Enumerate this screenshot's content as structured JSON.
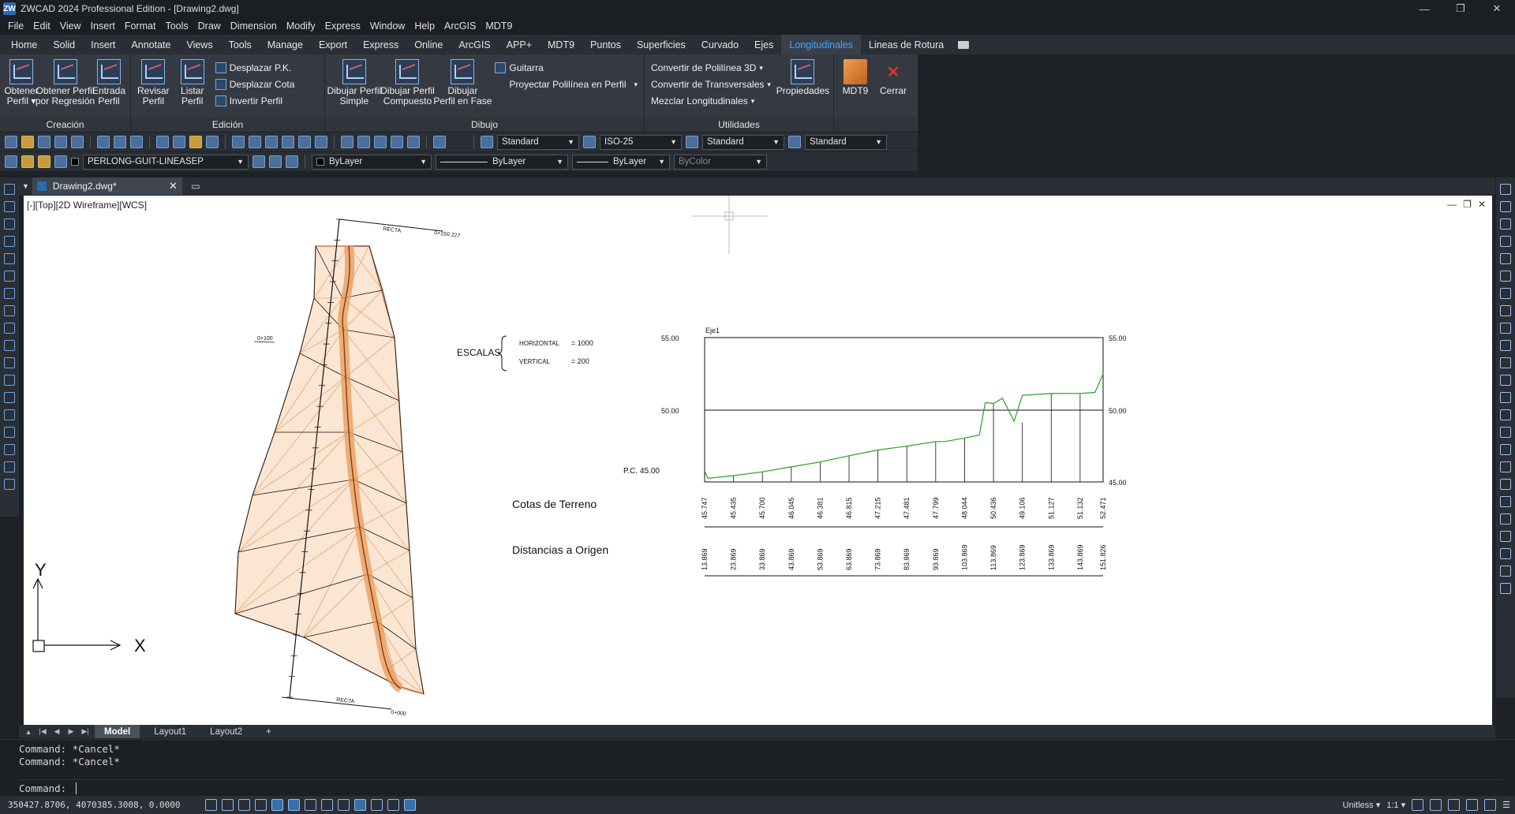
{
  "window": {
    "title": "ZWCAD 2024 Professional Edition - [Drawing2.dwg]",
    "app_icon": "ZW"
  },
  "menu": [
    "File",
    "Edit",
    "View",
    "Insert",
    "Format",
    "Tools",
    "Draw",
    "Dimension",
    "Modify",
    "Express",
    "Window",
    "Help",
    "ArcGIS",
    "MDT9"
  ],
  "ribbon_tabs": [
    "Home",
    "Solid",
    "Insert",
    "Annotate",
    "Views",
    "Tools",
    "Manage",
    "Export",
    "Express",
    "Online",
    "ArcGIS",
    "APP+",
    "MDT9",
    "Puntos",
    "Superficies",
    "Curvado",
    "Ejes",
    "Longitudinales",
    "Lineas de Rotura"
  ],
  "active_ribbon_tab": "Longitudinales",
  "ribbon": {
    "creacion": {
      "label": "Creación",
      "buttons": [
        {
          "l1": "Obtener",
          "l2": "Perfil ▾"
        },
        {
          "l1": "Obtener Perfil",
          "l2": "por Regresión"
        },
        {
          "l1": "Entrada",
          "l2": "Perfil"
        }
      ]
    },
    "edicion": {
      "label": "Edición",
      "buttons": [
        {
          "l1": "Revisar",
          "l2": "Perfil"
        },
        {
          "l1": "Listar",
          "l2": "Perfil"
        }
      ],
      "small": [
        "Desplazar P.K.",
        "Desplazar Cota",
        "Invertir Perfil"
      ]
    },
    "dibujo": {
      "label": "Dibujo",
      "buttons": [
        {
          "l1": "Dibujar Perfil",
          "l2": "Simple"
        },
        {
          "l1": "Dibujar Perfil",
          "l2": "Compuesto"
        },
        {
          "l1": "Dibujar",
          "l2": "Perfil en Fase"
        }
      ],
      "small": [
        "Guitarra",
        "Proyectar Polilínea en Perfil"
      ]
    },
    "utilidades": {
      "label": "Utilidades",
      "small": [
        "Convertir de Polilínea 3D",
        "Convertir de Transversales",
        "Mezclar Longitudinales"
      ],
      "props": "Propiedades"
    },
    "mdt": {
      "mdt9": "MDT9",
      "cerrar": "Cerrar"
    }
  },
  "toolbar": {
    "text_style": "Standard",
    "dim_style": "ISO-25",
    "table_style": "Standard",
    "mleader_style": "Standard",
    "layer": "PERLONG-GUIT-LINEASEP",
    "color": "ByLayer",
    "linetype": "ByLayer",
    "lineweight": "ByLayer",
    "plotstyle": "ByColor"
  },
  "doc_tab": "Drawing2.dwg*",
  "viewport_label": "[-][Top][2D Wireframe][WCS]",
  "drawing": {
    "plan_labels": {
      "recta_top": "RECTA",
      "recta_bottom": "RECTA",
      "pk_top": "0+150.227",
      "pk_mid": "0+100",
      "pk_bottom": "0+000"
    },
    "escalas": {
      "title": "ESCALAS",
      "h_label": "HORIZONTAL",
      "h_value": "= 1000",
      "v_label": "VERTICAL",
      "v_value": "= 200"
    },
    "axis_y": "Y",
    "axis_x": "X",
    "row_labels": {
      "cotas": "Cotas de Terreno",
      "distancias": "Distancias a Origen"
    },
    "pc_label": "P.C. 45.00",
    "y_ticks_left": [
      "55.00",
      "50.00"
    ],
    "y_ticks_right": [
      "55.00",
      "50.00",
      "45.00"
    ]
  },
  "chart_data": {
    "type": "line",
    "title": "Eje1",
    "xlabel": "",
    "ylabel": "",
    "ylim": [
      45,
      55
    ],
    "xlim": [
      13.869,
      151.826
    ],
    "grid": false,
    "series": [
      {
        "x": [
          13.869,
          15.0,
          23.869,
          33.869,
          43.869,
          53.869,
          63.869,
          73.869,
          83.869,
          93.869,
          97.0,
          103.869,
          109.0,
          111.0,
          113.869,
          117.0,
          121.0,
          123.869,
          123.869,
          133.869,
          143.869,
          149.0,
          151.826
        ],
        "y": [
          45.747,
          45.25,
          45.435,
          45.7,
          46.045,
          46.381,
          46.815,
          47.215,
          47.481,
          47.799,
          47.8,
          48.044,
          48.25,
          50.5,
          50.436,
          50.8,
          49.2,
          51.0,
          51.0,
          51.127,
          51.132,
          51.2,
          52.471
        ]
      }
    ],
    "station_labels": [
      "13.869",
      "23.869",
      "33.869",
      "43.869",
      "53.869",
      "63.869",
      "73.869",
      "83.869",
      "93.869",
      "103.869",
      "113.869",
      "123.869",
      "133.869",
      "143.869",
      "151.826"
    ],
    "elevation_labels": [
      "45.747",
      "45.435",
      "45.700",
      "46.045",
      "46.381",
      "46.815",
      "47.215",
      "47.481",
      "47.799",
      "48.044",
      "50.436",
      "49.106",
      "51.127",
      "51.132",
      "52.471"
    ],
    "line_color": "#22a322"
  },
  "layout_tabs": [
    "Model",
    "Layout1",
    "Layout2",
    "+"
  ],
  "command": {
    "history": [
      "Command: *Cancel*",
      "Command: *Cancel*"
    ],
    "prompt": "Command:"
  },
  "status": {
    "coords": "350427.8706, 4070385.3008, 0.0000",
    "units": "Unitless",
    "scale": "1:1"
  }
}
